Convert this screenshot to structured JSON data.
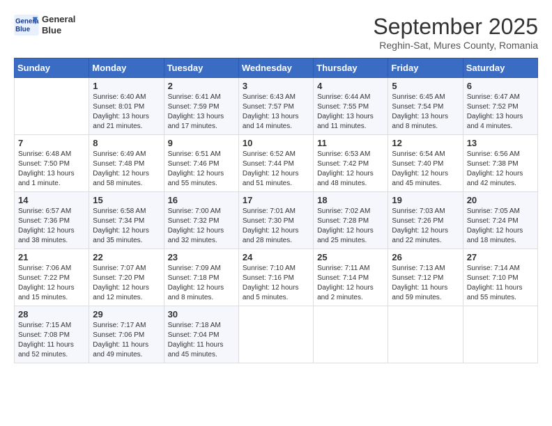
{
  "header": {
    "logo_line1": "General",
    "logo_line2": "Blue",
    "month": "September 2025",
    "location": "Reghin-Sat, Mures County, Romania"
  },
  "weekdays": [
    "Sunday",
    "Monday",
    "Tuesday",
    "Wednesday",
    "Thursday",
    "Friday",
    "Saturday"
  ],
  "weeks": [
    [
      {
        "day": "",
        "info": ""
      },
      {
        "day": "1",
        "info": "Sunrise: 6:40 AM\nSunset: 8:01 PM\nDaylight: 13 hours\nand 21 minutes."
      },
      {
        "day": "2",
        "info": "Sunrise: 6:41 AM\nSunset: 7:59 PM\nDaylight: 13 hours\nand 17 minutes."
      },
      {
        "day": "3",
        "info": "Sunrise: 6:43 AM\nSunset: 7:57 PM\nDaylight: 13 hours\nand 14 minutes."
      },
      {
        "day": "4",
        "info": "Sunrise: 6:44 AM\nSunset: 7:55 PM\nDaylight: 13 hours\nand 11 minutes."
      },
      {
        "day": "5",
        "info": "Sunrise: 6:45 AM\nSunset: 7:54 PM\nDaylight: 13 hours\nand 8 minutes."
      },
      {
        "day": "6",
        "info": "Sunrise: 6:47 AM\nSunset: 7:52 PM\nDaylight: 13 hours\nand 4 minutes."
      }
    ],
    [
      {
        "day": "7",
        "info": "Sunrise: 6:48 AM\nSunset: 7:50 PM\nDaylight: 13 hours\nand 1 minute."
      },
      {
        "day": "8",
        "info": "Sunrise: 6:49 AM\nSunset: 7:48 PM\nDaylight: 12 hours\nand 58 minutes."
      },
      {
        "day": "9",
        "info": "Sunrise: 6:51 AM\nSunset: 7:46 PM\nDaylight: 12 hours\nand 55 minutes."
      },
      {
        "day": "10",
        "info": "Sunrise: 6:52 AM\nSunset: 7:44 PM\nDaylight: 12 hours\nand 51 minutes."
      },
      {
        "day": "11",
        "info": "Sunrise: 6:53 AM\nSunset: 7:42 PM\nDaylight: 12 hours\nand 48 minutes."
      },
      {
        "day": "12",
        "info": "Sunrise: 6:54 AM\nSunset: 7:40 PM\nDaylight: 12 hours\nand 45 minutes."
      },
      {
        "day": "13",
        "info": "Sunrise: 6:56 AM\nSunset: 7:38 PM\nDaylight: 12 hours\nand 42 minutes."
      }
    ],
    [
      {
        "day": "14",
        "info": "Sunrise: 6:57 AM\nSunset: 7:36 PM\nDaylight: 12 hours\nand 38 minutes."
      },
      {
        "day": "15",
        "info": "Sunrise: 6:58 AM\nSunset: 7:34 PM\nDaylight: 12 hours\nand 35 minutes."
      },
      {
        "day": "16",
        "info": "Sunrise: 7:00 AM\nSunset: 7:32 PM\nDaylight: 12 hours\nand 32 minutes."
      },
      {
        "day": "17",
        "info": "Sunrise: 7:01 AM\nSunset: 7:30 PM\nDaylight: 12 hours\nand 28 minutes."
      },
      {
        "day": "18",
        "info": "Sunrise: 7:02 AM\nSunset: 7:28 PM\nDaylight: 12 hours\nand 25 minutes."
      },
      {
        "day": "19",
        "info": "Sunrise: 7:03 AM\nSunset: 7:26 PM\nDaylight: 12 hours\nand 22 minutes."
      },
      {
        "day": "20",
        "info": "Sunrise: 7:05 AM\nSunset: 7:24 PM\nDaylight: 12 hours\nand 18 minutes."
      }
    ],
    [
      {
        "day": "21",
        "info": "Sunrise: 7:06 AM\nSunset: 7:22 PM\nDaylight: 12 hours\nand 15 minutes."
      },
      {
        "day": "22",
        "info": "Sunrise: 7:07 AM\nSunset: 7:20 PM\nDaylight: 12 hours\nand 12 minutes."
      },
      {
        "day": "23",
        "info": "Sunrise: 7:09 AM\nSunset: 7:18 PM\nDaylight: 12 hours\nand 8 minutes."
      },
      {
        "day": "24",
        "info": "Sunrise: 7:10 AM\nSunset: 7:16 PM\nDaylight: 12 hours\nand 5 minutes."
      },
      {
        "day": "25",
        "info": "Sunrise: 7:11 AM\nSunset: 7:14 PM\nDaylight: 12 hours\nand 2 minutes."
      },
      {
        "day": "26",
        "info": "Sunrise: 7:13 AM\nSunset: 7:12 PM\nDaylight: 11 hours\nand 59 minutes."
      },
      {
        "day": "27",
        "info": "Sunrise: 7:14 AM\nSunset: 7:10 PM\nDaylight: 11 hours\nand 55 minutes."
      }
    ],
    [
      {
        "day": "28",
        "info": "Sunrise: 7:15 AM\nSunset: 7:08 PM\nDaylight: 11 hours\nand 52 minutes."
      },
      {
        "day": "29",
        "info": "Sunrise: 7:17 AM\nSunset: 7:06 PM\nDaylight: 11 hours\nand 49 minutes."
      },
      {
        "day": "30",
        "info": "Sunrise: 7:18 AM\nSunset: 7:04 PM\nDaylight: 11 hours\nand 45 minutes."
      },
      {
        "day": "",
        "info": ""
      },
      {
        "day": "",
        "info": ""
      },
      {
        "day": "",
        "info": ""
      },
      {
        "day": "",
        "info": ""
      }
    ]
  ]
}
